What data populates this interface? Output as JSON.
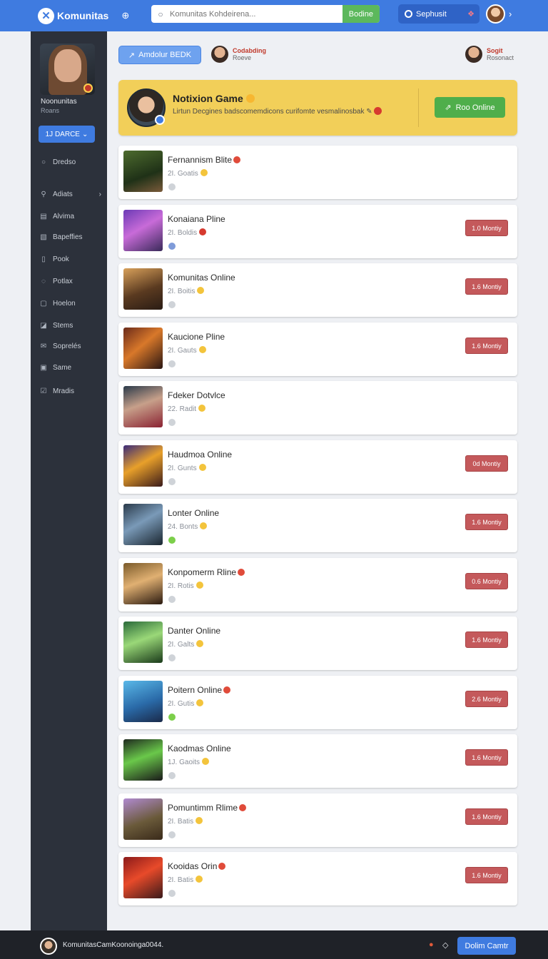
{
  "app": {
    "title": "Komunitas"
  },
  "search": {
    "placeholder": "Komunitas Kohdeirena...",
    "button_label": "Bodine"
  },
  "user_menu": {
    "label": "Sephusit"
  },
  "sidebar": {
    "profile_name": "Noonunitas",
    "profile_sub": "Roans",
    "dropdown_label": "1J DARCE",
    "items": [
      {
        "icon": "circle-icon",
        "label": "Dredso"
      },
      {
        "icon": "search-icon",
        "label": "Adiats",
        "has_chevron": true
      },
      {
        "icon": "gamepad-icon",
        "label": "Alvima"
      },
      {
        "icon": "page-icon",
        "label": "Bapeffies"
      },
      {
        "icon": "book-icon",
        "label": "Pook"
      },
      {
        "icon": "chat-icon",
        "label": "Potlax"
      },
      {
        "icon": "box-icon",
        "label": "Hoelon"
      },
      {
        "icon": "edit-icon",
        "label": "Stems"
      },
      {
        "icon": "mail-icon",
        "label": "Soprelés"
      },
      {
        "icon": "square-icon",
        "label": "Same"
      },
      {
        "icon": "check-square-icon",
        "label": "Mradis"
      }
    ]
  },
  "header": {
    "action_button": "Amdolur BEDK",
    "user_left": {
      "name": "Codabding",
      "sub": "Roeve"
    },
    "user_right": {
      "name": "Sogit",
      "sub": "Rosonact"
    }
  },
  "featured": {
    "title": "Notixion Game",
    "description": "Lirtun Decgines badscomemdicons curifomte vesmalinosbak",
    "button_label": "Roo Online"
  },
  "games": [
    {
      "title": "Fernannism Blite",
      "sub": "2I. Goatis",
      "hot": true,
      "play_label": ""
    },
    {
      "title": "Konaiana Pline",
      "sub": "2I. Boldis",
      "hot": false,
      "play_label": "1.0 Montiy"
    },
    {
      "title": "Komunitas Online",
      "sub": "2I. Boitis",
      "hot": false,
      "play_label": "1.6 Montiy"
    },
    {
      "title": "Kaucione Pline",
      "sub": "2I. Gauts",
      "hot": false,
      "play_label": "1.6 Montiy"
    },
    {
      "title": "Fdeker Dotvlce",
      "sub": "22. Radit",
      "hot": false,
      "play_label": ""
    },
    {
      "title": "Haudmoa Online",
      "sub": "2I. Gunts",
      "hot": false,
      "play_label": "0d Montiy"
    },
    {
      "title": "Lonter Online",
      "sub": "24. Bonts",
      "hot": false,
      "play_label": "1.6 Montiy"
    },
    {
      "title": "Konpomerm Rline",
      "sub": "2I. Rotis",
      "hot": true,
      "play_label": "0.6 Montiy"
    },
    {
      "title": "Danter Online",
      "sub": "2I. Galts",
      "hot": false,
      "play_label": "1.6 Montiy"
    },
    {
      "title": "Poitern Online",
      "sub": "2I. Gutis",
      "hot": true,
      "play_label": "2.6 Montiy"
    },
    {
      "title": "Kaodmas Online",
      "sub": "1J. Gaoits",
      "hot": false,
      "play_label": "1.6 Montiy"
    },
    {
      "title": "Pomuntimm Rlime",
      "sub": "2I. Batis",
      "hot": true,
      "play_label": "1.6 Montiy"
    },
    {
      "title": "Kooidas Orin",
      "sub": "2I. Batis",
      "hot": true,
      "play_label": "1.6 Montiy"
    }
  ],
  "footer": {
    "text": "KomunitasCamKoonoinga0044.",
    "button_label": "Dolim Camtr"
  }
}
